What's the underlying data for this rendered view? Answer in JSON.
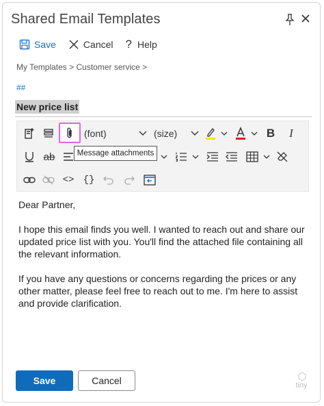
{
  "window": {
    "title": "Shared Email Templates"
  },
  "commands": {
    "save": "Save",
    "cancel": "Cancel",
    "help": "Help"
  },
  "breadcrumb": "My Templates > Customer service >",
  "hashtag": "##",
  "subject": "New price list",
  "toolbar": {
    "font_select": "(font)",
    "size_select": "(size)",
    "tooltip": "Message attachments",
    "highlight_color": "#f2e600",
    "font_color": "#d21f1f"
  },
  "body": {
    "greeting": "Dear Partner,",
    "paragraph1": "I hope this email finds you well. I wanted to reach out and share our updated price list with you. You'll find the attached file containing all the relevant information.",
    "paragraph2": "If you have any questions or concerns regarding the prices or any other matter, please feel free to reach out to me. I'm here to assist and provide clarification."
  },
  "footer": {
    "save": "Save",
    "cancel": "Cancel",
    "brand": "tiny"
  },
  "colors": {
    "accent": "#0f6cbd",
    "attach_highlight": "#e066e0"
  }
}
